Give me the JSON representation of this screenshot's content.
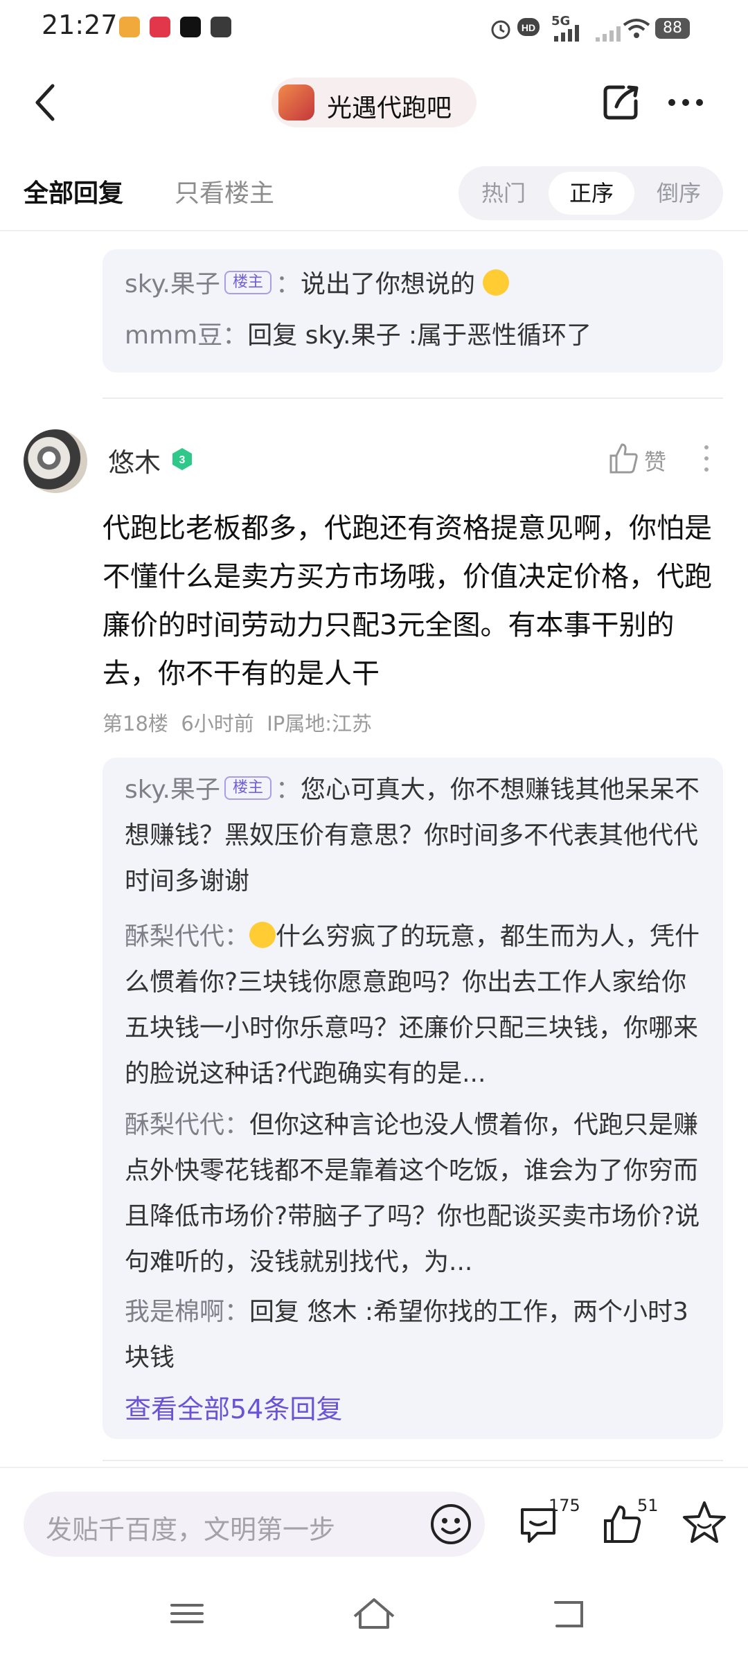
{
  "status_bar": {
    "time": "21:27",
    "network": "5G",
    "battery": "88"
  },
  "header": {
    "forum_title": "光遇代跑吧"
  },
  "tabs": {
    "all_replies": "全部回复",
    "op_only": "只看楼主",
    "sort_options": [
      "热门",
      "正序",
      "倒序"
    ],
    "selected_sort": "正序"
  },
  "top_reply_box": {
    "replies": [
      {
        "author": "sky.果子",
        "tag": "楼主",
        "text": "说出了你想说的"
      },
      {
        "author": "mmm豆",
        "text": "回复 sky.果子 :属于恶性循环了"
      }
    ]
  },
  "post": {
    "author": "悠木",
    "level": "3",
    "like_label": "赞",
    "body": "代跑比老板都多，代跑还有资格提意见啊，你怕是不懂什么是卖方买方市场哦，价值决定价格，代跑廉价的时间劳动力只配3元全图。有本事干别的去，你不干有的是人干",
    "floor": "第18楼",
    "time": "6小时前",
    "ip": "IP属地:江苏"
  },
  "post_replies": {
    "replies": [
      {
        "author": "sky.果子",
        "tag": "楼主",
        "text": "您心可真大，你不想赚钱其他呆呆不想赚钱？黑奴压价有意思？你时间多不代表其他代代时间多谢谢"
      },
      {
        "author": "酥梨代代",
        "text": "什么穷疯了的玩意，都生而为人，凭什么惯着你?三块钱你愿意跑吗？你出去工作人家给你五块钱一小时你乐意吗？还廉价只配三块钱，你哪来的脸说这种话?代跑确实有的是..."
      },
      {
        "author": "酥梨代代",
        "text": "但你这种言论也没人惯着你，代跑只是赚点外快零花钱都不是靠着这个吃饭，谁会为了你穷而且降低市场价?带脑子了吗？你也配谈买卖市场价?说句难听的，没钱就别找代，为..."
      },
      {
        "author": "我是棉啊",
        "text": "回复 悠木 :希望你找的工作，两个小时3块钱"
      }
    ],
    "view_all": "查看全部54条回复"
  },
  "bottom_bar": {
    "compose_placeholder": "发贴千百度，文明第一步",
    "comment_count": "175",
    "like_count": "51"
  },
  "colors": {
    "accent": "#6a53d4",
    "reply_bg": "#f3f3fa",
    "op_tag": "#6f5fd6"
  }
}
